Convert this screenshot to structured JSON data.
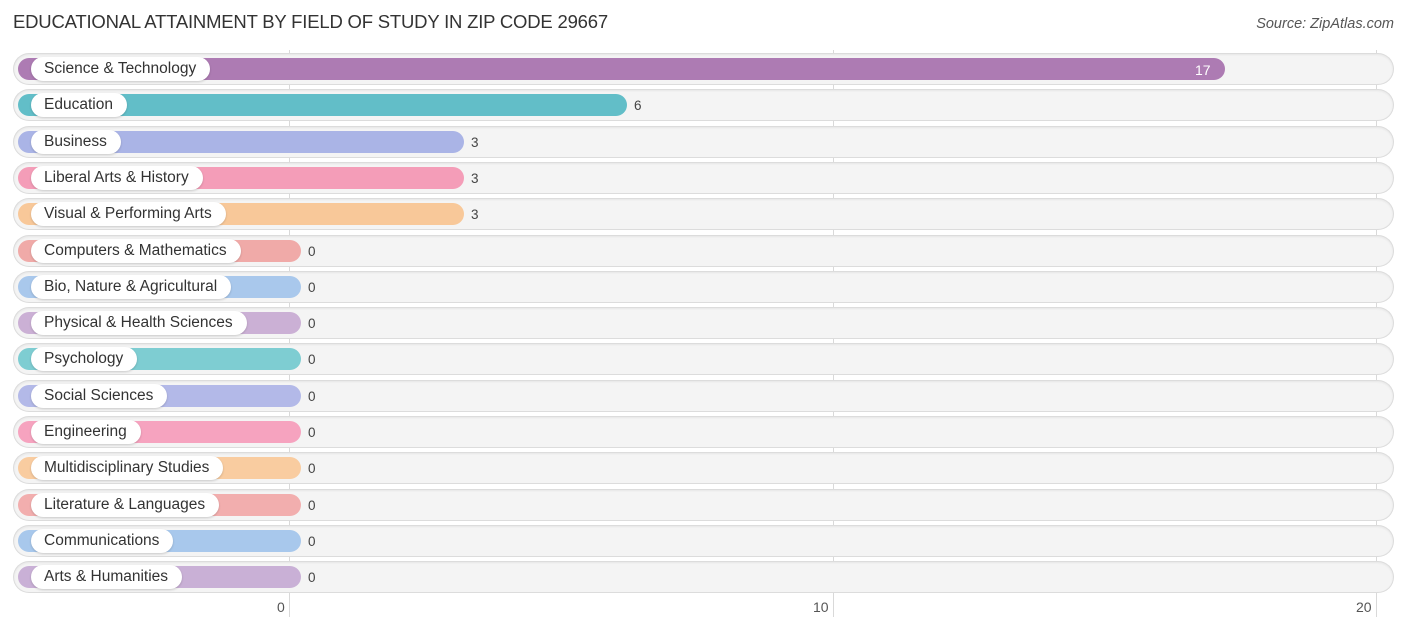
{
  "chart_data": {
    "type": "bar",
    "orientation": "horizontal",
    "title": "EDUCATIONAL ATTAINMENT BY FIELD OF STUDY IN ZIP CODE 29667",
    "source": "Source: ZipAtlas.com",
    "xlabel": "",
    "ylabel": "",
    "xlim": [
      0,
      20
    ],
    "xticks": [
      0,
      10,
      20
    ],
    "grid": true,
    "categories": [
      "Science & Technology",
      "Education",
      "Business",
      "Liberal Arts & History",
      "Visual & Performing Arts",
      "Computers & Mathematics",
      "Bio, Nature & Agricultural",
      "Physical & Health Sciences",
      "Psychology",
      "Social Sciences",
      "Engineering",
      "Multidisciplinary Studies",
      "Literature & Languages",
      "Communications",
      "Arts & Humanities"
    ],
    "values": [
      17,
      6,
      3,
      3,
      3,
      0,
      0,
      0,
      0,
      0,
      0,
      0,
      0,
      0,
      0
    ],
    "colors": [
      "#ad7bb3",
      "#62bec8",
      "#aab4e6",
      "#f49db8",
      "#f8c899",
      "#f0aaa8",
      "#a9c8ec",
      "#cbb0d5",
      "#7ecdd2",
      "#b3b9e8",
      "#f6a3bf",
      "#f9cca0",
      "#f2aeae",
      "#a8c8ec",
      "#c9b0d6"
    ]
  }
}
